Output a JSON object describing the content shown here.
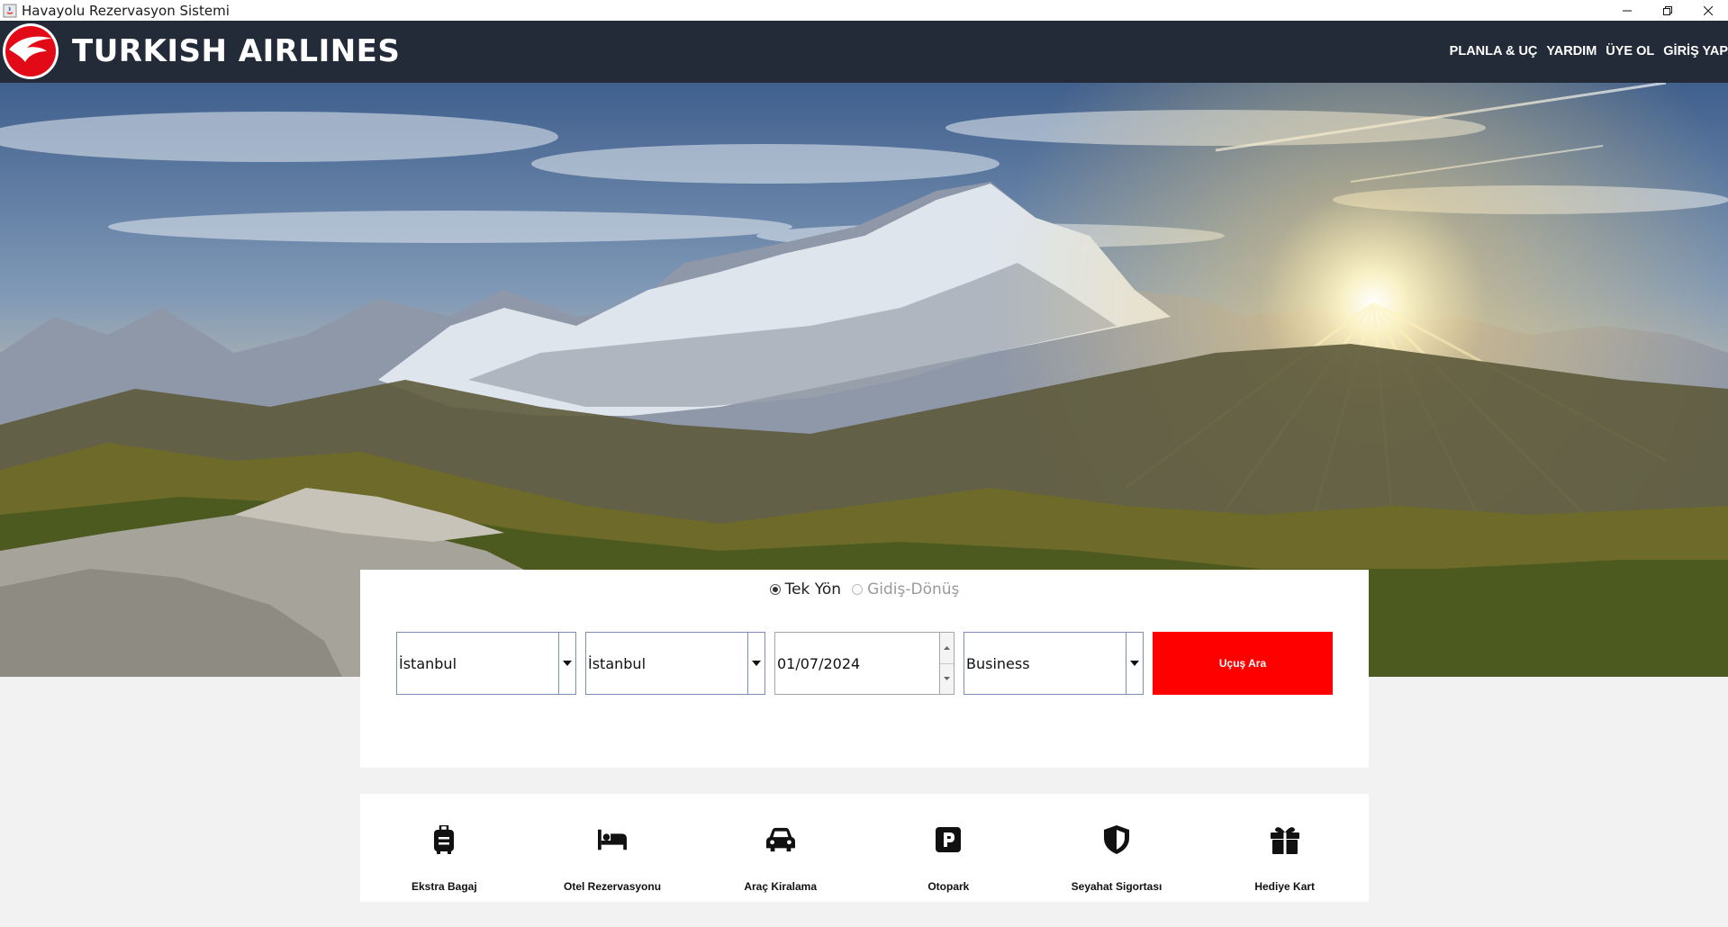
{
  "window": {
    "title": "Havayolu Rezervasyon Sistemi",
    "controls": [
      "minimize",
      "restore",
      "close"
    ]
  },
  "header": {
    "brand": "TURKISH AIRLINES",
    "nav": [
      {
        "label": "PLANLA & UÇ"
      },
      {
        "label": "YARDIM"
      },
      {
        "label": "ÜYE OL"
      },
      {
        "label": "GİRİŞ YAP"
      }
    ]
  },
  "search": {
    "trip_types": [
      {
        "label": "Tek Yön",
        "selected": true
      },
      {
        "label": "Gidiş-Dönüş",
        "selected": false
      }
    ],
    "from": {
      "value": "İstanbul"
    },
    "to": {
      "value": "İstanbul"
    },
    "date": {
      "value": "01/07/2024"
    },
    "cabin": {
      "value": "Business"
    },
    "submit_label": "Uçuş Ara"
  },
  "services": [
    {
      "label": "Ekstra Bagaj",
      "icon": "luggage-icon"
    },
    {
      "label": "Otel Rezervasyonu",
      "icon": "bed-icon"
    },
    {
      "label": "Araç Kiralama",
      "icon": "car-icon"
    },
    {
      "label": "Otopark",
      "icon": "parking-icon"
    },
    {
      "label": "Seyahat Sigortası",
      "icon": "shield-icon"
    },
    {
      "label": "Hediye Kart",
      "icon": "gift-icon"
    }
  ],
  "colors": {
    "header_bg": "#232b38",
    "accent_red": "#ff0000",
    "brand_red": "#e30a17",
    "panel_bg": "#ffffff",
    "page_bg": "#f2f2f2"
  }
}
